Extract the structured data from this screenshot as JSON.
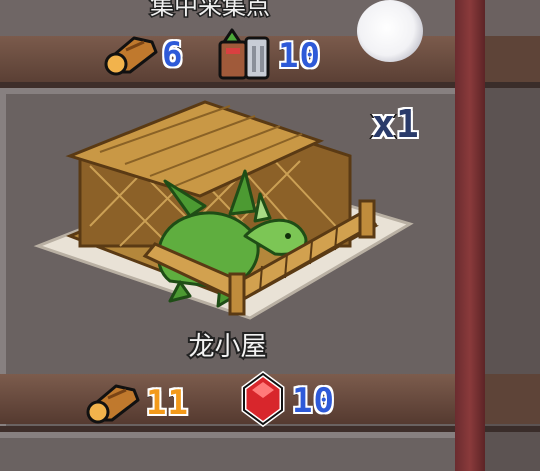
{
  "top_card": {
    "title": "集中采集点",
    "costs": [
      {
        "icon": "wood-log-icon",
        "value": "6",
        "color": "#2e5ad8"
      },
      {
        "icon": "food-basket-icon",
        "value": "10",
        "color": "#2e5ad8"
      }
    ]
  },
  "main_card": {
    "name": "龙小屋",
    "quantity": "x1",
    "image": "dragon-hut-icon",
    "costs": [
      {
        "icon": "wood-log-icon",
        "value": "11",
        "color": "#f39a1b"
      },
      {
        "icon": "red-gem-icon",
        "value": "10",
        "color": "#2e5ad8"
      }
    ]
  },
  "overlay": {
    "icon": "glowing-orb-icon"
  },
  "colors": {
    "panel": "#6a6261",
    "cost_bar": "#7c5c4d",
    "divider": "#8a3a3b"
  }
}
